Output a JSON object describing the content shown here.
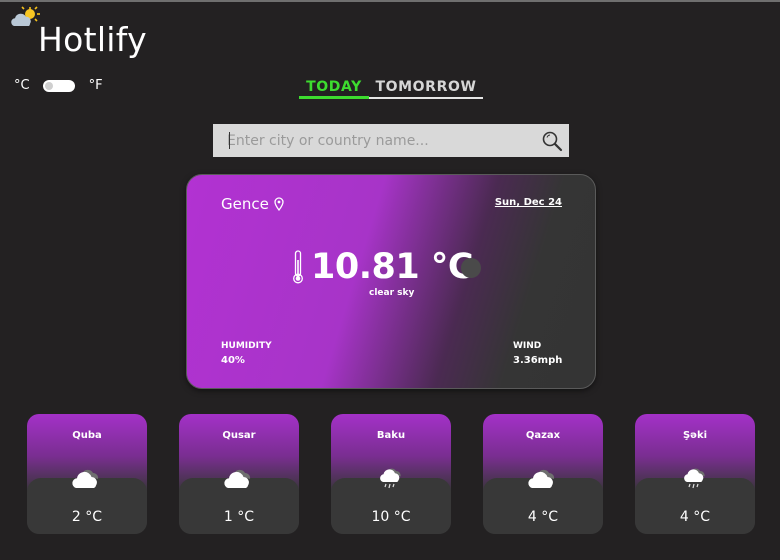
{
  "app": {
    "title": "Hotlify"
  },
  "units": {
    "celsius": "°C",
    "fahrenheit": "°F"
  },
  "tabs": [
    {
      "label": "TODAY",
      "active": true
    },
    {
      "label": "TOMORROW",
      "active": false
    }
  ],
  "search": {
    "placeholder": "Enter city or country name...",
    "value": ""
  },
  "current": {
    "city": "Gence",
    "date": "Sun, Dec 24",
    "temperature": "10.81 °C",
    "condition": "clear sky",
    "humidity_label": "HUMIDITY",
    "humidity_value": "40%",
    "wind_label": "WIND",
    "wind_value": "3.36mph"
  },
  "cities": [
    {
      "name": "Quba",
      "temp": "2 °C",
      "icon": "cloud-icon"
    },
    {
      "name": "Qusar",
      "temp": "1 °C",
      "icon": "cloud-icon"
    },
    {
      "name": "Baku",
      "temp": "10 °C",
      "icon": "rain-cloud-icon"
    },
    {
      "name": "Qazax",
      "temp": "4 °C",
      "icon": "cloud-icon"
    },
    {
      "name": "Şəki",
      "temp": "4 °C",
      "icon": "rain-cloud-icon"
    }
  ],
  "colors": {
    "background": "#232122",
    "accent_green": "#3ddc2f",
    "card_purple": "#b232d2"
  }
}
